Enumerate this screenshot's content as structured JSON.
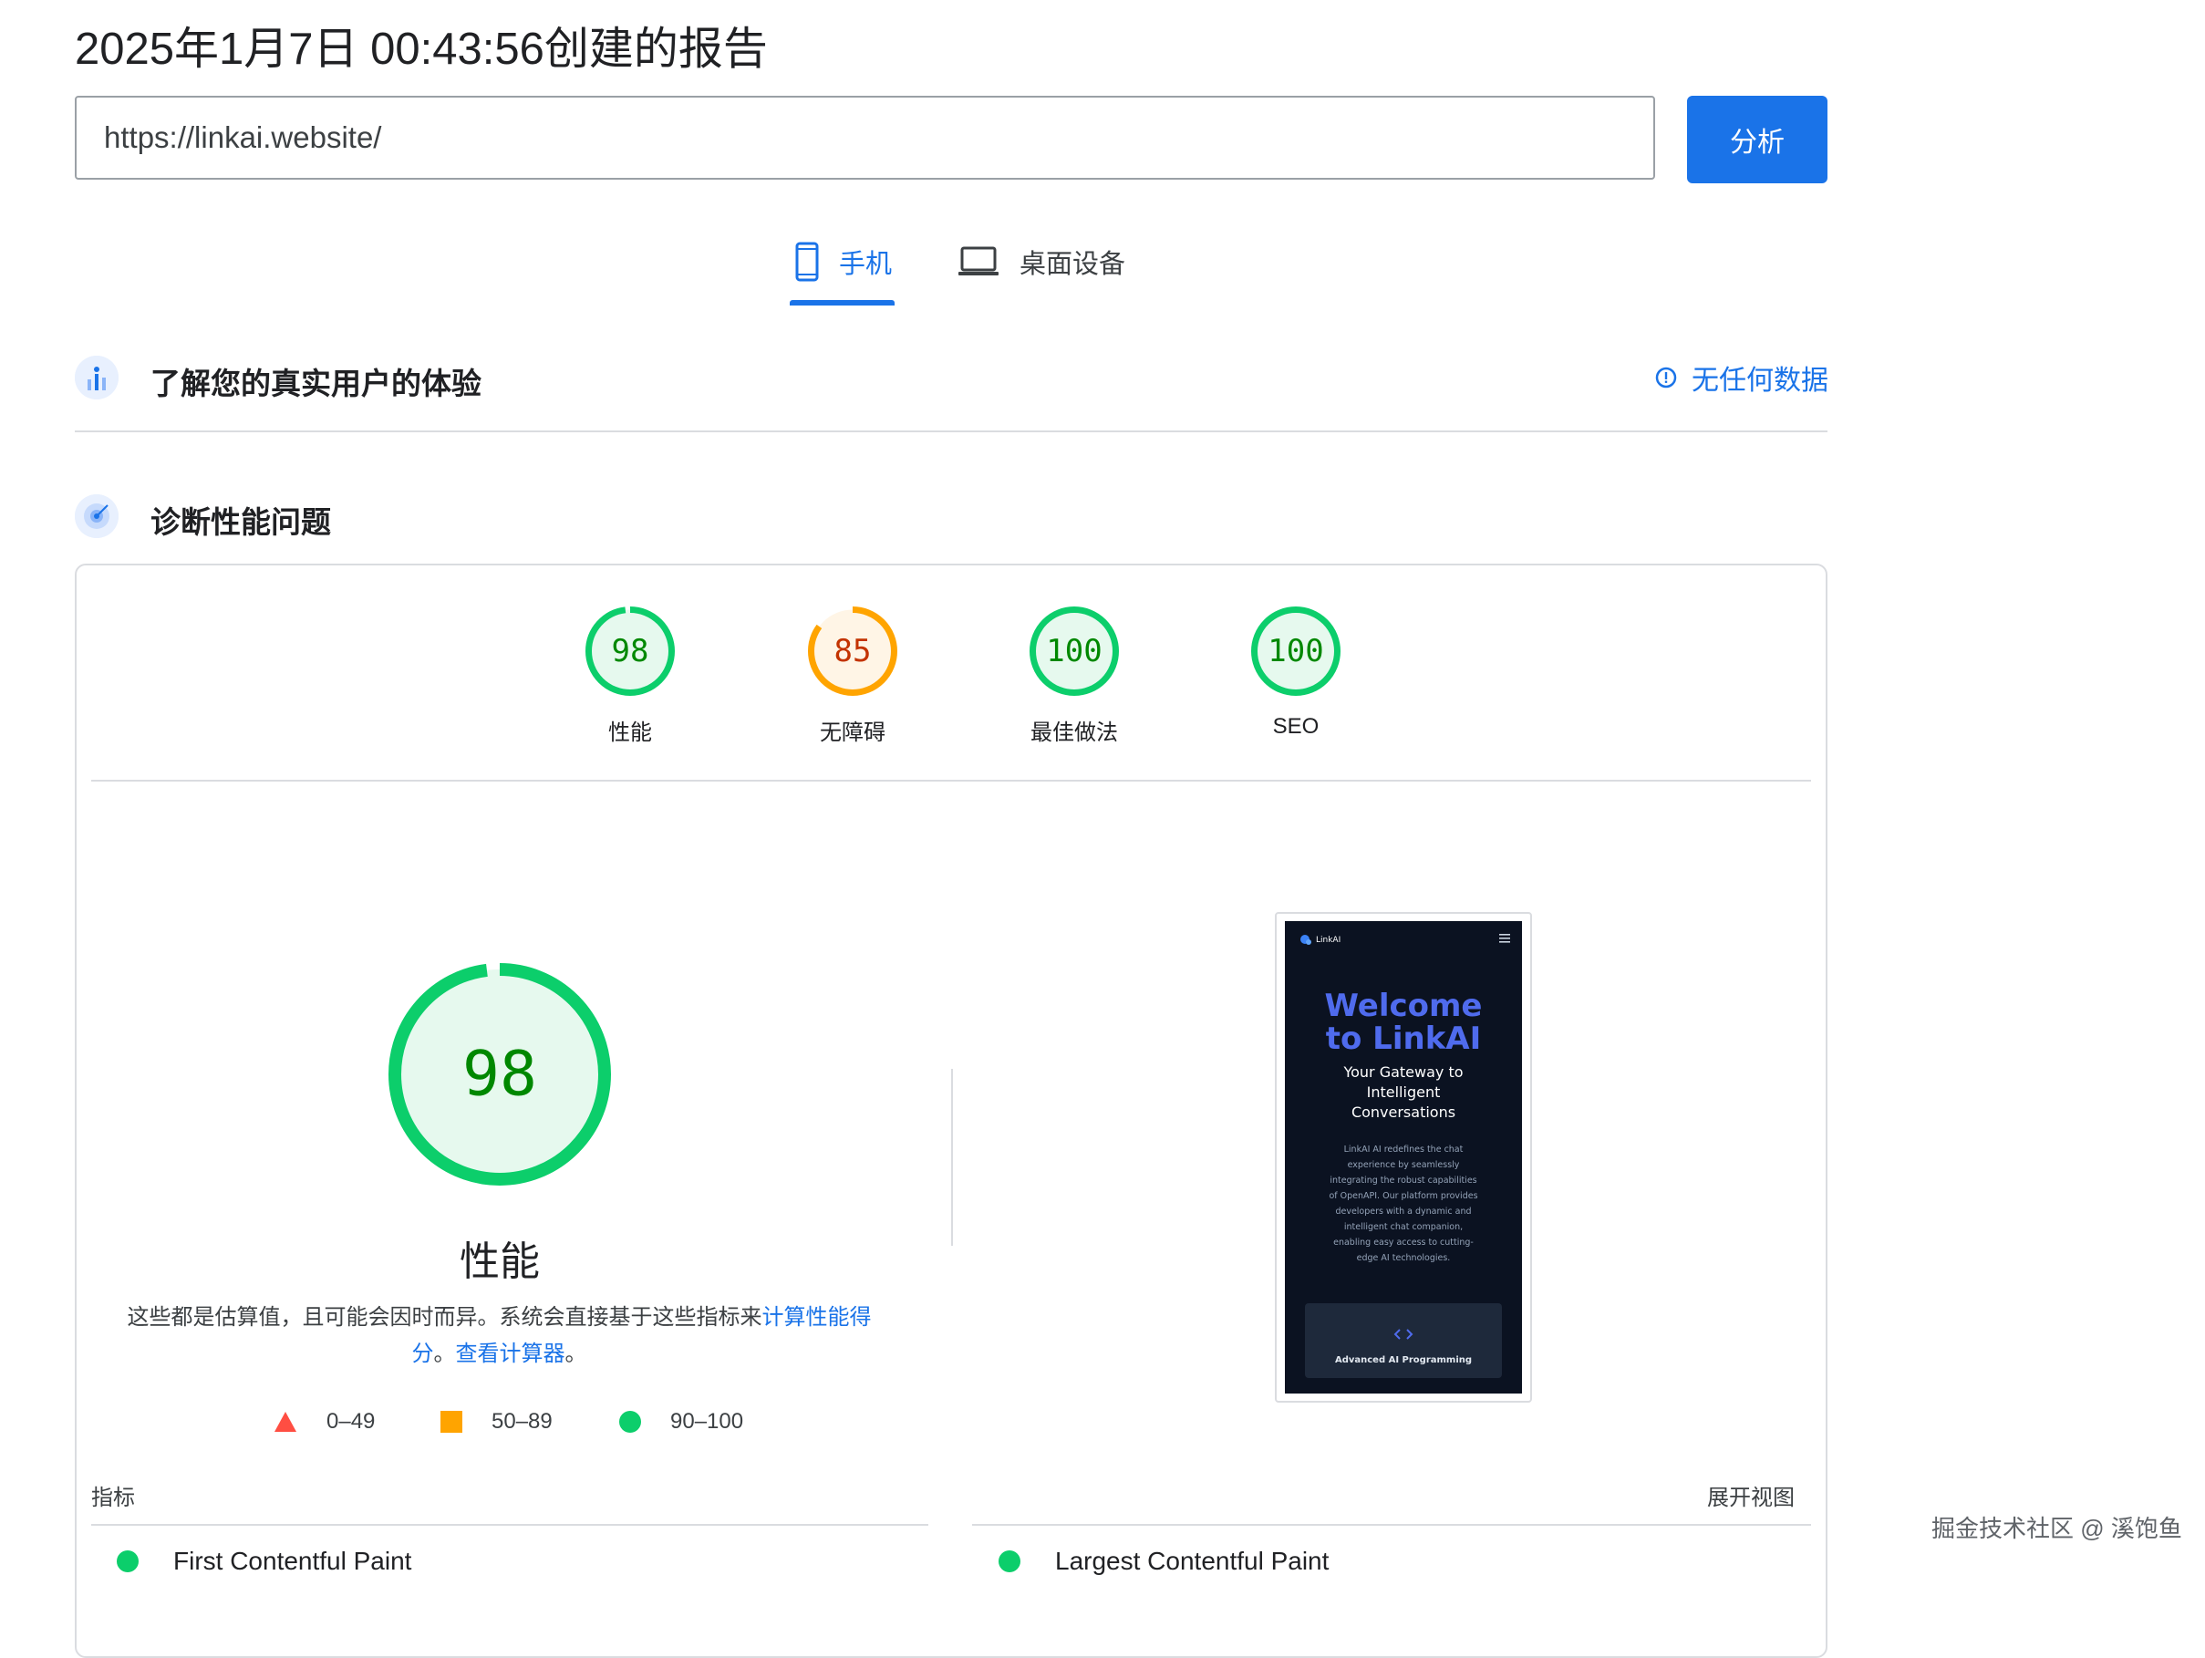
{
  "header": {
    "title": "2025年1月7日 00:43:56创建的报告",
    "url_value": "https://linkai.website/",
    "analyze_label": "分析"
  },
  "tabs": [
    {
      "label": "手机",
      "icon": "smartphone-icon",
      "active": true
    },
    {
      "label": "桌面设备",
      "icon": "laptop-icon",
      "active": false
    }
  ],
  "crux": {
    "title": "了解您的真实用户的体验",
    "link_label": "无任何数据"
  },
  "diagnose": {
    "title": "诊断性能问题"
  },
  "scores": [
    {
      "value": "98",
      "label": "性能",
      "level": "good"
    },
    {
      "value": "85",
      "label": "无障碍",
      "level": "average"
    },
    {
      "value": "100",
      "label": "最佳做法",
      "level": "good"
    },
    {
      "value": "100",
      "label": "SEO",
      "level": "good"
    }
  ],
  "performance": {
    "score": "98",
    "title": "性能",
    "desc_prefix": "这些都是估算值，且可能会因时而异。系统会直接基于这些指标来",
    "calc_link": "计算性能得分",
    "desc_mid": "。",
    "calculator_link": "查看计算器",
    "desc_suffix": "。"
  },
  "legend": [
    {
      "range": "0–49",
      "shape": "triangle",
      "color": "#ff4e42"
    },
    {
      "range": "50–89",
      "shape": "square",
      "color": "#ffa400"
    },
    {
      "range": "90–100",
      "shape": "circle",
      "color": "#0cce6b"
    }
  ],
  "screenshot": {
    "brand": "LinkAI",
    "headline_1": "Welcome",
    "headline_2": "to LinkAI",
    "sub_1": "Your Gateway to",
    "sub_2": "Intelligent",
    "sub_3": "Conversations",
    "body_lines": [
      "LinkAI AI redefines the chat",
      "experience by seamlessly",
      "integrating the robust capabilities",
      "of OpenAPI. Our platform provides",
      "developers with a dynamic and",
      "intelligent chat companion,",
      "enabling easy access to cutting-",
      "edge AI technologies."
    ],
    "card_label": "Advanced AI Programming"
  },
  "metrics": {
    "label": "指标",
    "expand_label": "展开视图",
    "items": [
      "First Contentful Paint",
      "Largest Contentful Paint"
    ]
  },
  "watermark": "掘金技术社区 @ 溪饱鱼",
  "colors": {
    "accent": "#1a73e8",
    "good": "#0cce6b",
    "good_text": "#008800",
    "good_bg": "#e6f9ee",
    "average": "#ffa400",
    "average_text": "#c33300",
    "average_bg": "#fff5e6",
    "fail": "#ff4e42"
  }
}
